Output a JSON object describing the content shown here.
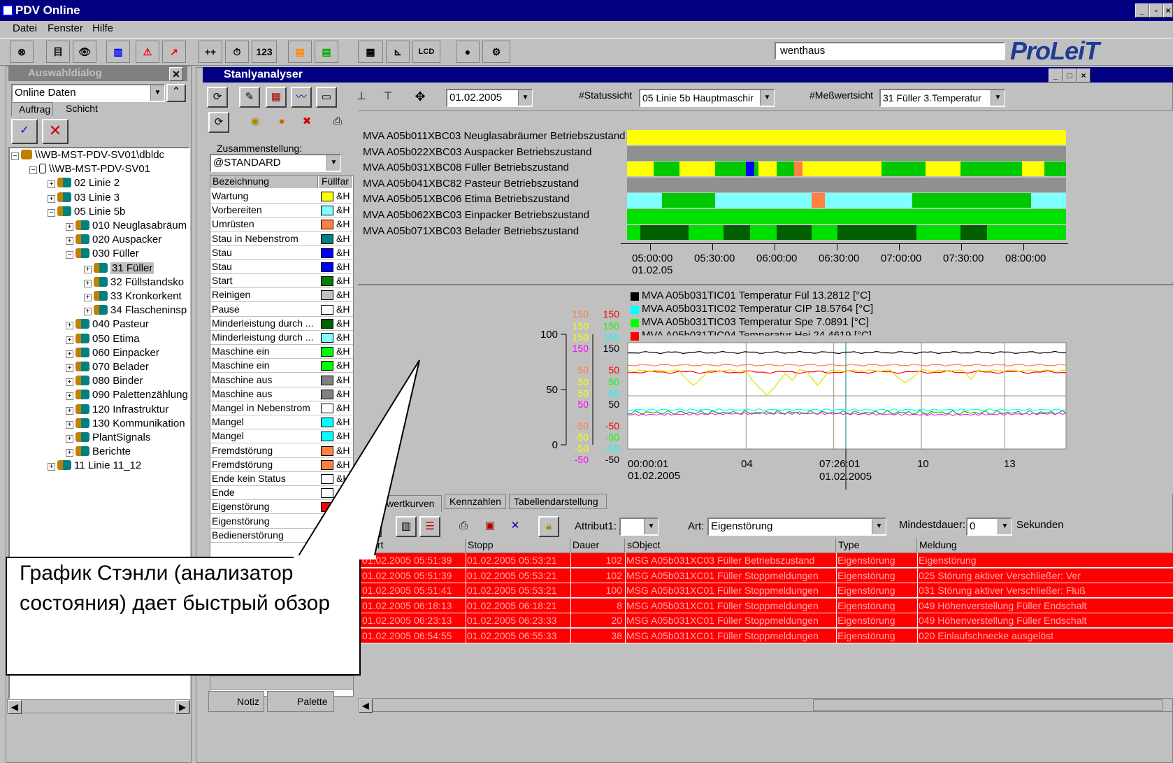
{
  "app": {
    "title": "PDV Online",
    "menu": [
      "Datei",
      "Fenster",
      "Hilfe"
    ],
    "search_value": "wenthaus",
    "logo": "ProLeiT"
  },
  "toolbar": [
    "⊗",
    "目",
    "👁",
    "▥",
    "⚠",
    "↗",
    "++",
    "⏱",
    "123",
    "▤",
    "▤",
    "▦",
    "⊾",
    "LCD",
    "●",
    "⚙"
  ],
  "left_panel": {
    "title": "Auswahldialog",
    "combo": "Online Daten",
    "tabs": [
      "Auftrag",
      "Schicht"
    ],
    "tree": [
      {
        "label": "\\\\WB-MST-PDV-SV01\\dbldc",
        "indent": 0,
        "sign": "-",
        "icon": "db"
      },
      {
        "label": "\\\\WB-MST-PDV-SV01",
        "indent": 1,
        "sign": "-",
        "icon": "srv"
      },
      {
        "label": "02 Linie 2",
        "indent": 2,
        "sign": "+"
      },
      {
        "label": "03 Linie 3",
        "indent": 2,
        "sign": "+"
      },
      {
        "label": "05 Linie 5b",
        "indent": 2,
        "sign": "-"
      },
      {
        "label": "010 Neuglasabräum",
        "indent": 3,
        "sign": "+"
      },
      {
        "label": "020 Auspacker",
        "indent": 3,
        "sign": "+"
      },
      {
        "label": "030 Füller",
        "indent": 3,
        "sign": "-"
      },
      {
        "label": "31 Füller",
        "indent": 4,
        "sign": "+",
        "sel": true
      },
      {
        "label": "32 Füllstandsko",
        "indent": 4,
        "sign": "+"
      },
      {
        "label": "33 Kronkorkent",
        "indent": 4,
        "sign": "+"
      },
      {
        "label": "34 Flascheninsp",
        "indent": 4,
        "sign": "+"
      },
      {
        "label": "040 Pasteur",
        "indent": 3,
        "sign": "+"
      },
      {
        "label": "050 Etima",
        "indent": 3,
        "sign": "+"
      },
      {
        "label": "060 Einpacker",
        "indent": 3,
        "sign": "+"
      },
      {
        "label": "070 Belader",
        "indent": 3,
        "sign": "+"
      },
      {
        "label": "080 Binder",
        "indent": 3,
        "sign": "+"
      },
      {
        "label": "090 Palettenzählung",
        "indent": 3,
        "sign": "+"
      },
      {
        "label": "120 Infrastruktur",
        "indent": 3,
        "sign": "+"
      },
      {
        "label": "130 Kommunikation",
        "indent": 3,
        "sign": "+"
      },
      {
        "label": "PlantSignals",
        "indent": 3,
        "sign": "+"
      },
      {
        "label": "Berichte",
        "indent": 3,
        "sign": "+"
      },
      {
        "label": "11 Linie 11_12",
        "indent": 2,
        "sign": "+"
      }
    ]
  },
  "stanl": {
    "title": "Stanlyanalyser",
    "date": "01.02.2005",
    "status_label": "#Statussicht",
    "status_value": "05 Linie 5b Hauptmaschir",
    "mess_label": "#Meßwertsicht",
    "mess_value": "31 Füller 3.Temperatur"
  },
  "legend": {
    "zus_label": "Zusammenstellung:",
    "zus_value": "@STANDARD",
    "col1": "Bezeichnung",
    "col2": "Füllfar",
    "rows": [
      {
        "name": "Wartung",
        "color": "#ffff00"
      },
      {
        "name": "Vorbereiten",
        "color": "#80ffff"
      },
      {
        "name": "Umrüsten",
        "color": "#ff8040"
      },
      {
        "name": "Stau in Nebenstrom",
        "color": "#008080"
      },
      {
        "name": "Stau",
        "color": "#0000ff"
      },
      {
        "name": "Stau",
        "color": "#0000ff"
      },
      {
        "name": "Start",
        "color": "#008000"
      },
      {
        "name": "Reinigen",
        "color": "#c0c0c0"
      },
      {
        "name": "Pause",
        "color": "#ffffff"
      },
      {
        "name": "Minderleistung durch ...",
        "color": "#006000"
      },
      {
        "name": "Minderleistung durch ...",
        "color": "#80ffff"
      },
      {
        "name": "Maschine ein",
        "color": "#00ff00"
      },
      {
        "name": "Maschine ein",
        "color": "#00ff00"
      },
      {
        "name": "Maschine aus",
        "color": "#808080"
      },
      {
        "name": "Maschine aus",
        "color": "#808080"
      },
      {
        "name": "Mangel in Nebenstrom",
        "color": "#ffffff"
      },
      {
        "name": "Mangel",
        "color": "#00ffff"
      },
      {
        "name": "Mangel",
        "color": "#00ffff"
      },
      {
        "name": "Fremdstörung",
        "color": "#ff8040"
      },
      {
        "name": "Fremdstörung",
        "color": "#ff8040"
      },
      {
        "name": "Ende kein Status",
        "color": "#ffffff"
      },
      {
        "name": "Ende",
        "color": "#ffffff"
      },
      {
        "name": "Eigenstörung",
        "color": "#ff0000"
      },
      {
        "name": "Eigenstörung",
        "color": "#ff0000"
      },
      {
        "name": "Bedienerstörung",
        "color": "#ffff00"
      }
    ],
    "hh": "&H",
    "tabs": [
      "Notiz",
      "Palette"
    ]
  },
  "status_rows": [
    "MVA A05b011XBC03 Neuglasabräumer Betriebszustand",
    "MVA A05b022XBC03 Auspacker Betriebszustand",
    "MVA A05b031XBC08 Füller Betriebszustand",
    "MVA A05b041XBC82 Pasteur Betriebszustand",
    "MVA A05b051XBC06 Etima Betriebszustand",
    "MVA A05b062XBC03 Einpacker Betriebszustand",
    "MVA A05b071XBC03 Belader Betriebszustand"
  ],
  "status_times": [
    "05:00:00",
    "05:30:00",
    "06:00:00",
    "06:30:00",
    "07:00:00",
    "07:30:00",
    "08:00:00"
  ],
  "status_date": "01.02.05",
  "chart_data": {
    "type": "line",
    "series": [
      {
        "name": "MVA A05b031TIC01 Temperatur Fül 13.2812 [°C]",
        "color": "#000000"
      },
      {
        "name": "MVA A05b031TIC02 Temperatur CIP 18.5764 [°C]",
        "color": "#00ffff"
      },
      {
        "name": "MVA A05b031TIC03 Temperatur Spe 7.0891 [°C]",
        "color": "#00ff00"
      },
      {
        "name": "MVA A05b031TIC04 Temperatur Hei 24.4619 [°C]",
        "color": "#ff0000"
      }
    ],
    "left_axis": [
      "100",
      "50",
      "0"
    ],
    "scale_values": [
      "150",
      "50",
      "-50"
    ],
    "x_ticks": [
      "00:00:01",
      "04",
      "07:26:01",
      "10",
      "13"
    ],
    "x_dates": [
      "01.02.2005",
      "01.02.2005"
    ]
  },
  "lower_tabs": [
    "Meßwertkurven",
    "Kennzahlen",
    "Tabellendarstellung"
  ],
  "filter": {
    "attr_label": "Attribut1:",
    "art_label": "Art:",
    "art_value": "Eigenstörung",
    "min_label": "Mindestdauer:",
    "min_value": "0",
    "sek": "Sekunden"
  },
  "table": {
    "headers": [
      "Start",
      "Stopp",
      "Dauer",
      "sObject",
      "Type",
      "Meldung"
    ],
    "rows": [
      [
        "01.02.2005 05:51:39",
        "01.02.2005 05:53:21",
        "102",
        "MSG A05b031XC03 Füller Betriebszustand",
        "Eigenstörung",
        "Eigenstörung"
      ],
      [
        "01.02.2005 05:51:39",
        "01.02.2005 05:53:21",
        "102",
        "MSG A05b031XC01 Füller Stoppmeldungen",
        "Eigenstörung",
        "025 Störung aktiver Verschließer: Ver"
      ],
      [
        "01.02.2005 05:51:41",
        "01.02.2005 05:53:21",
        "100",
        "MSG A05b031XC01 Füller Stoppmeldungen",
        "Eigenstörung",
        "031 Störung aktiver Verschließer: Fluß"
      ],
      [
        "01.02.2005 06:18:13",
        "01.02.2005 06:18:21",
        "8",
        "MSG A05b031XC01 Füller Stoppmeldungen",
        "Eigenstörung",
        "049 Höhenverstellung Füller Endschalt"
      ],
      [
        "01.02.2005 06:23:13",
        "01.02.2005 06:23:33",
        "20",
        "MSG A05b031XC01 Füller Stoppmeldungen",
        "Eigenstörung",
        "049 Höhenverstellung Füller Endschalt"
      ],
      [
        "01.02.2005 06:54:55",
        "01.02.2005 06:55:33",
        "38",
        "MSG A05b031XC01 Füller Stoppmeldungen",
        "Eigenstörung",
        "020 Einlaufschnecke ausgelöst"
      ]
    ]
  },
  "callout": "График Стэнли (анализатор состояния) дает быстрый обзор"
}
